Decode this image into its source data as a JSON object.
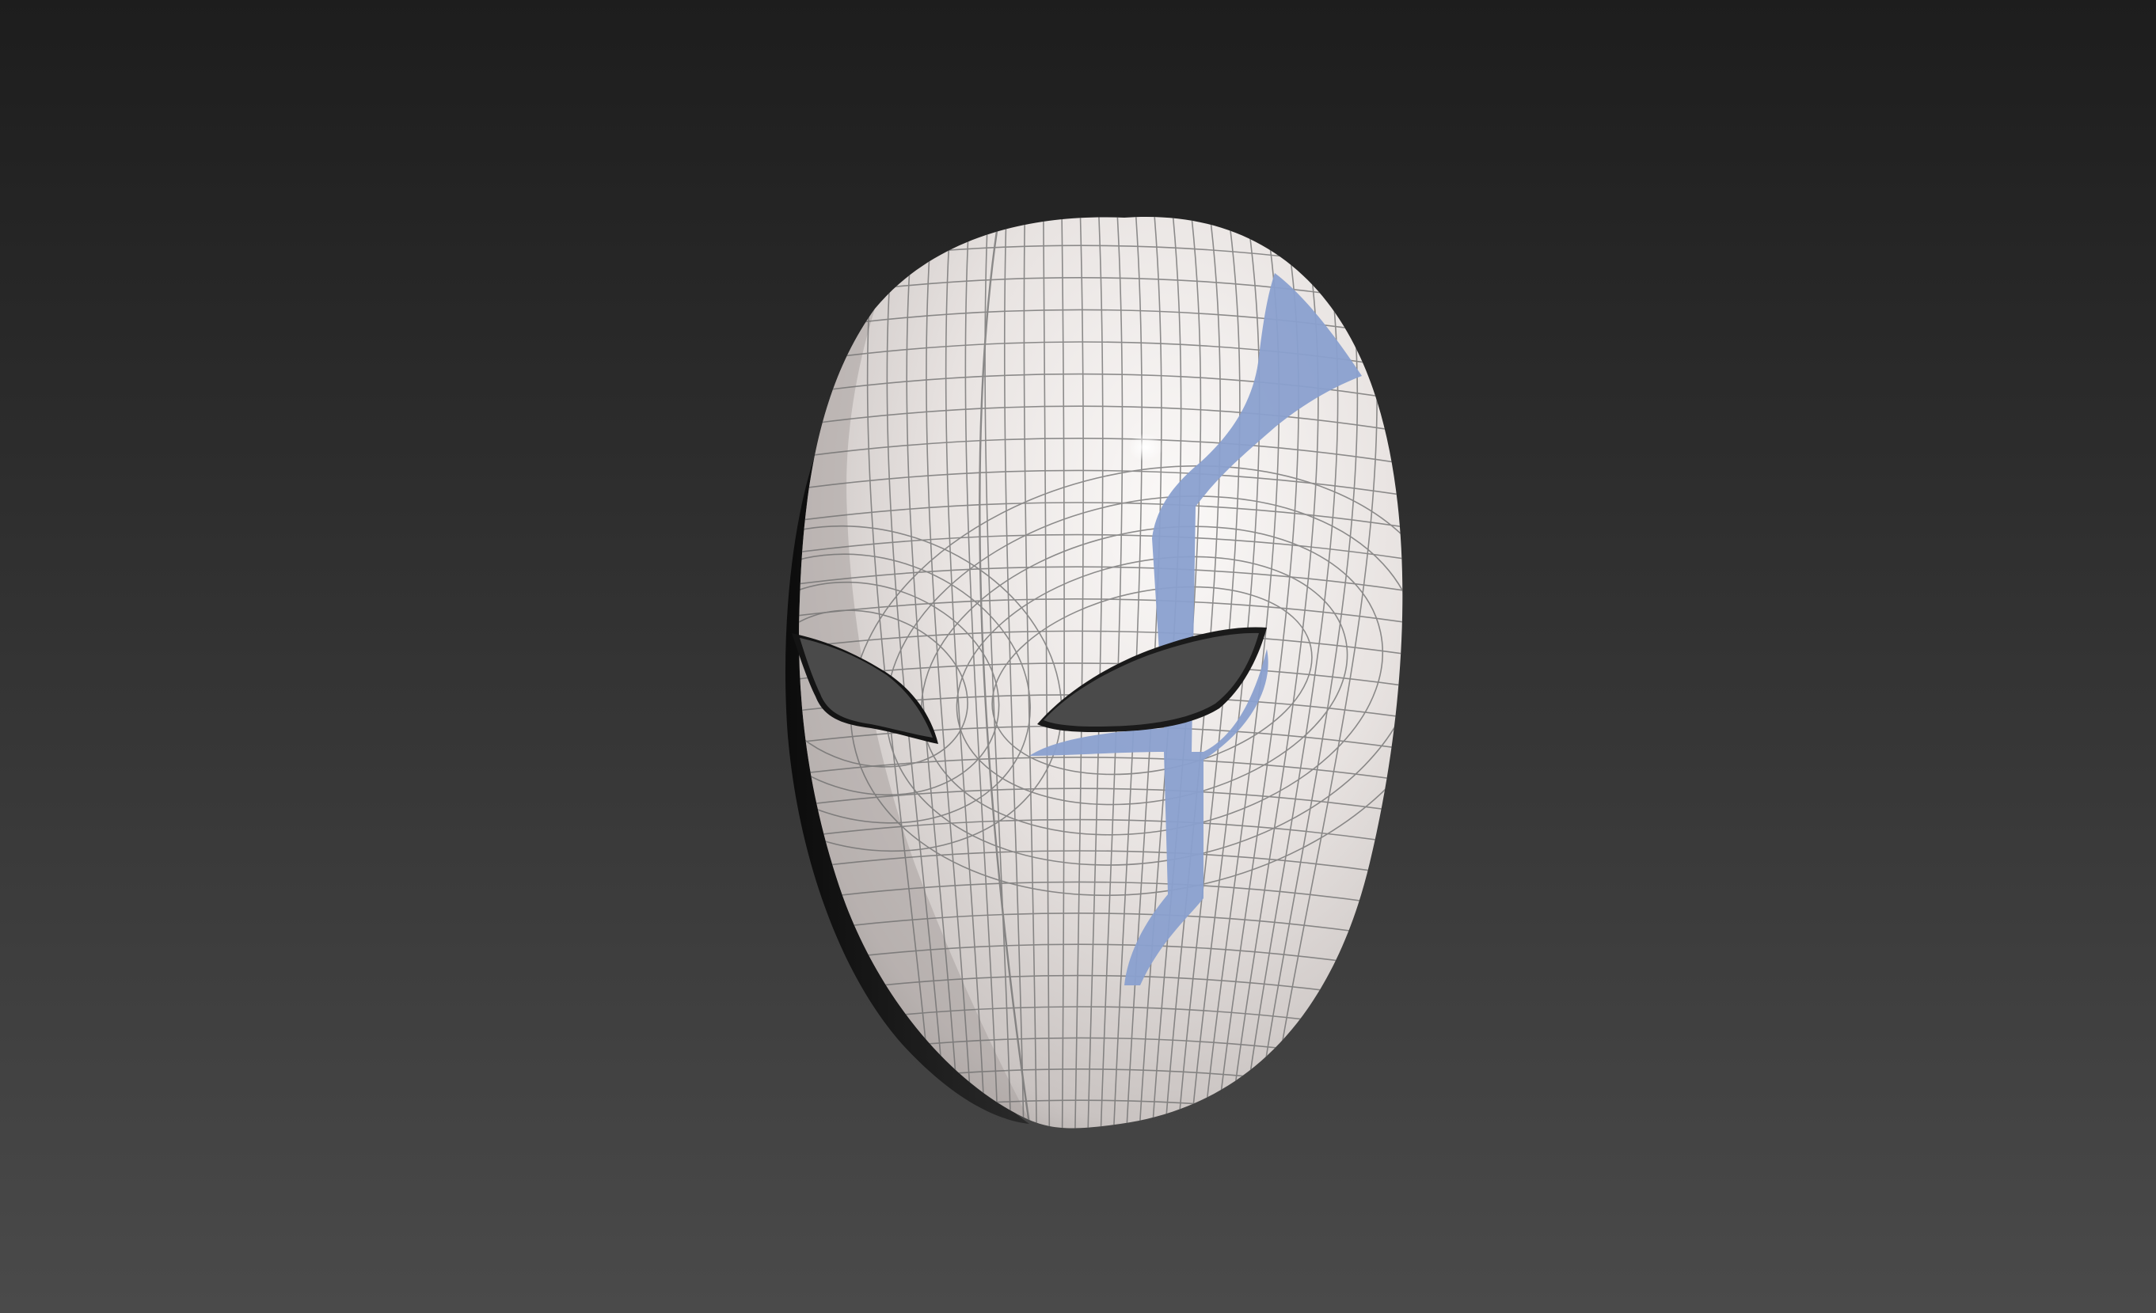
{
  "viewport": {
    "background_top": "#1d1d1d",
    "background_bottom": "#4a4a4a",
    "shading_mode": "shaded-with-wireframe"
  },
  "mask_model": {
    "object": "mask",
    "base_color": "#ece8e6",
    "shadow_color": "#8d8886",
    "wireframe_color": "#6b6b6b",
    "stripe_color": "#8aa0cf",
    "eye_hole_color": "#4a4a4a",
    "inner_rim_color": "#141414"
  }
}
